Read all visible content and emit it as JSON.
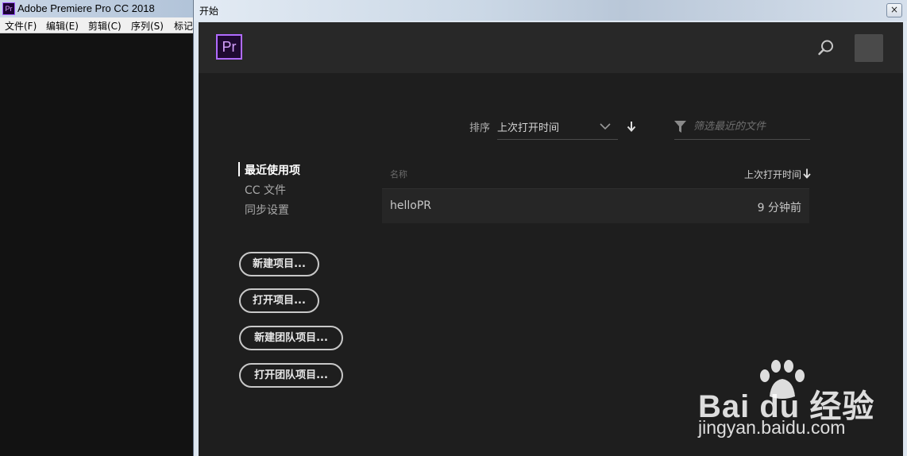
{
  "main_window": {
    "title": "Adobe Premiere Pro CC 2018",
    "app_icon": "premiere-pro-icon",
    "menu": [
      "文件(F)",
      "编辑(E)",
      "剪辑(C)",
      "序列(S)",
      "标记"
    ]
  },
  "dialog": {
    "title": "开始",
    "close_label": "×"
  },
  "header": {
    "logo_text": "Pr",
    "search_icon": "search-icon",
    "avatar_icon": "user-avatar"
  },
  "sort": {
    "label": "排序",
    "value": "上次打开时间",
    "direction_icon": "arrow-down-icon"
  },
  "filter": {
    "placeholder": "筛选最近的文件",
    "value": ""
  },
  "nav": {
    "items": [
      {
        "label": "最近使用项",
        "active": true
      },
      {
        "label": "CC 文件",
        "active": false
      },
      {
        "label": "同步设置",
        "active": false
      }
    ]
  },
  "buttons": {
    "new_project": "新建项目...",
    "open_project": "打开项目...",
    "new_team_project": "新建团队项目...",
    "open_team_project": "打开团队项目..."
  },
  "files": {
    "columns": {
      "name": "名称",
      "last_opened": "上次打开时间"
    },
    "rows": [
      {
        "name": "helloPR",
        "last_opened": "9 分钟前"
      }
    ]
  },
  "watermark": {
    "logo_text": "Bai du 经验",
    "url": "jingyan.baidu.com"
  },
  "colors": {
    "accent": "#b06bff",
    "background": "#1e1e1e",
    "header": "#282828"
  }
}
